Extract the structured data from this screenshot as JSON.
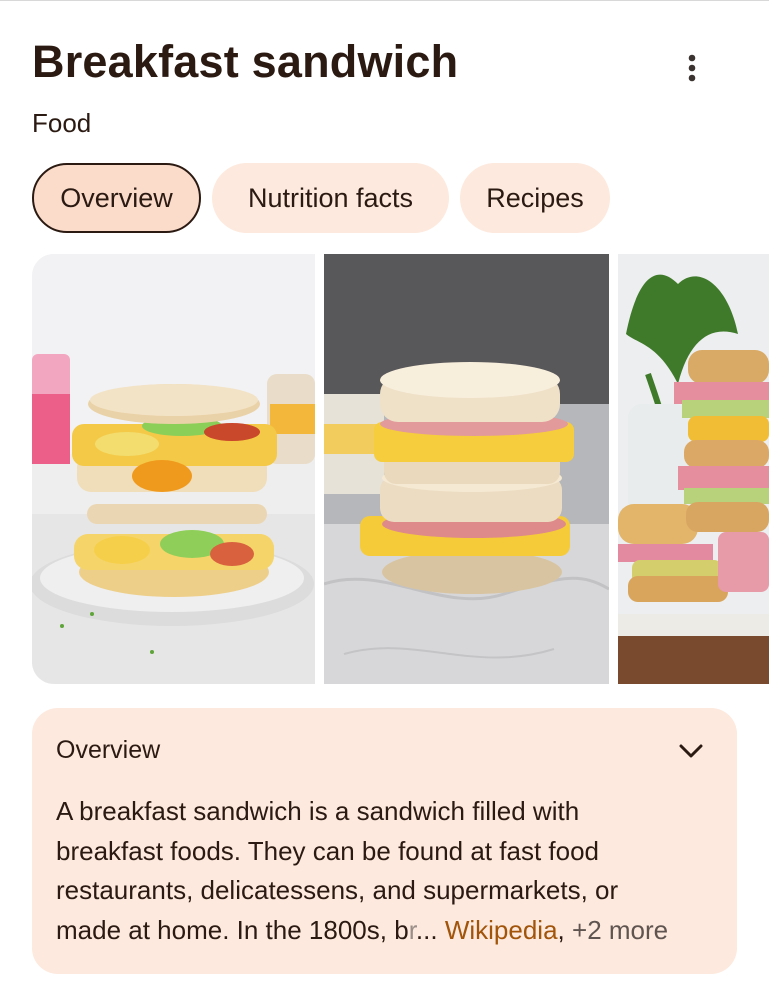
{
  "header": {
    "title": "Breakfast sandwich",
    "subtitle": "Food"
  },
  "tabs": [
    {
      "label": "Overview",
      "active": true
    },
    {
      "label": "Nutrition facts",
      "active": false
    },
    {
      "label": "Recipes",
      "active": false
    }
  ],
  "icons": {
    "more": "more-vert-icon",
    "expand": "chevron-down-icon"
  },
  "overview": {
    "heading": "Overview",
    "lines": [
      "A breakfast sandwich is a sandwich filled with",
      "breakfast foods. They can be found at fast food",
      "restaurants, delicatessens, and supermarkets, or"
    ],
    "last_line_start": "made at home. In the 1800s, b",
    "last_line_faded": "r",
    "ellipsis": "...",
    "source_link": "Wikipedia",
    "separator": ",",
    "more_sources": "+2 more"
  },
  "colors": {
    "text": "#2b1a12",
    "chip_bg": "#fde9dd",
    "chip_active_bg": "#fbdccb",
    "link": "#a1540a",
    "card_bg": "#fde9dd"
  }
}
